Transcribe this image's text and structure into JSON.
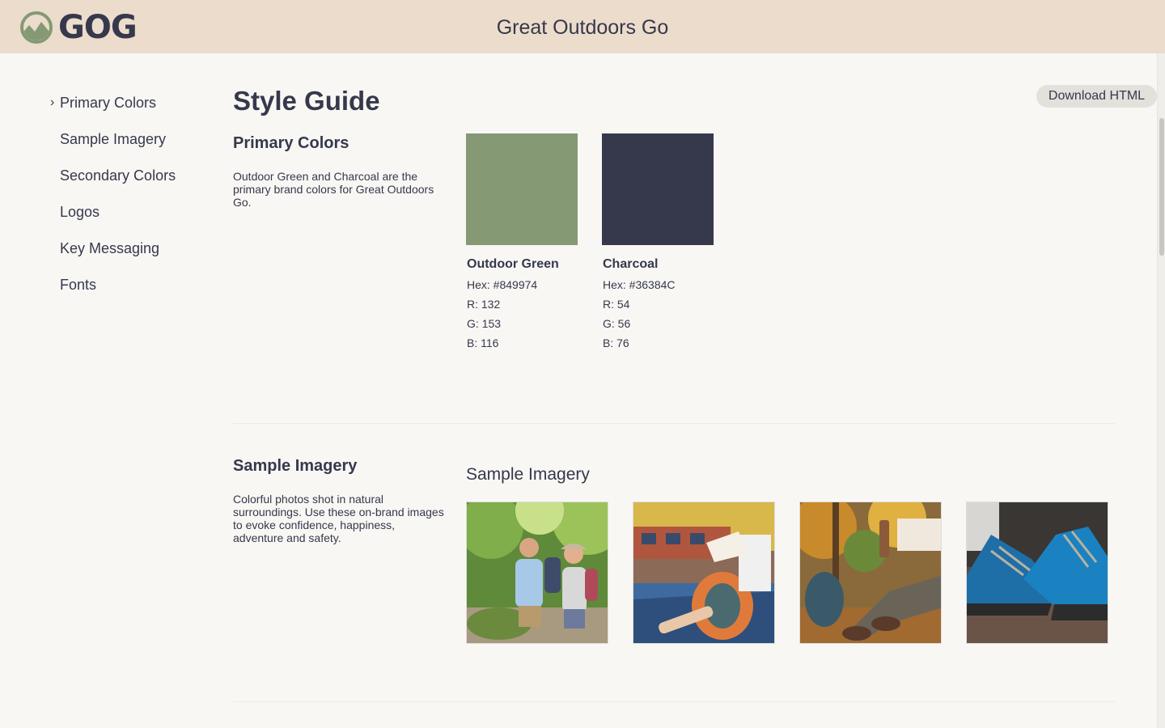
{
  "header": {
    "logo_text": "GOG",
    "title": "Great Outdoors Go"
  },
  "sidebar": {
    "items": [
      {
        "label": "Primary Colors",
        "active": true
      },
      {
        "label": "Sample Imagery",
        "active": false
      },
      {
        "label": "Secondary Colors",
        "active": false
      },
      {
        "label": "Logos",
        "active": false
      },
      {
        "label": "Key Messaging",
        "active": false
      },
      {
        "label": "Fonts",
        "active": false
      }
    ],
    "active_marker": "›"
  },
  "page": {
    "title": "Style Guide",
    "download_label": "Download HTML"
  },
  "primary_colors": {
    "heading": "Primary Colors",
    "description": "Outdoor Green and Charcoal are the primary brand colors for Great Outdoors Go.",
    "swatches": [
      {
        "name": "Outdoor Green",
        "hex_line": "Hex: #849974",
        "r": "R: 132",
        "g": "G: 153",
        "b": "B: 116",
        "color": "#849974"
      },
      {
        "name": "Charcoal",
        "hex_line": "Hex: #36384C",
        "r": "R: 54",
        "g": "G: 56",
        "b": "B: 76",
        "color": "#36384c"
      }
    ]
  },
  "sample_imagery": {
    "heading": "Sample Imagery",
    "description": "Colorful photos shot in natural surroundings. Use these on-brand images to evoke confidence, happiness, adventure and safety.",
    "title": "Sample Imagery",
    "images": [
      {
        "name": "hikers-photo"
      },
      {
        "name": "train-backpack-photo"
      },
      {
        "name": "autumn-thermos-photo"
      },
      {
        "name": "hiking-boots-photo"
      }
    ]
  },
  "colors": {
    "header_bg": "#ecdccb",
    "page_bg": "#f9f7f4",
    "text": "#36384c",
    "brand_green": "#849974",
    "brand_charcoal": "#36384c"
  }
}
